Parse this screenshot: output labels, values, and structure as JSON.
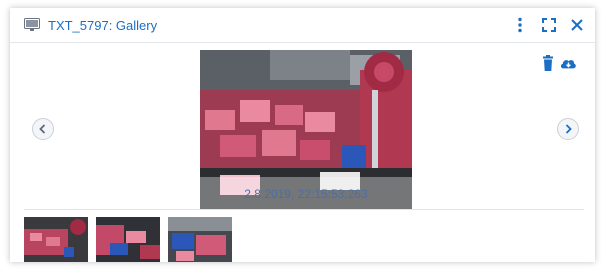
{
  "window": {
    "title": "TXT_5797: Gallery",
    "title_color": "#1a6fc4"
  },
  "toolbar": {
    "icons": [
      "more-vertical-icon",
      "fullscreen-icon",
      "close-icon",
      "trash-icon",
      "cloud-download-icon"
    ]
  },
  "viewer": {
    "caption": "2.8.2019, 22:15:53.263",
    "nav_icons": [
      "chevron-left-icon",
      "chevron-right-icon"
    ]
  },
  "thumbnails": [
    {
      "label": ""
    },
    {
      "label": ""
    },
    {
      "label": ""
    }
  ],
  "colors": {
    "accent": "#1a6fc4",
    "border": "#e3e6ea"
  }
}
